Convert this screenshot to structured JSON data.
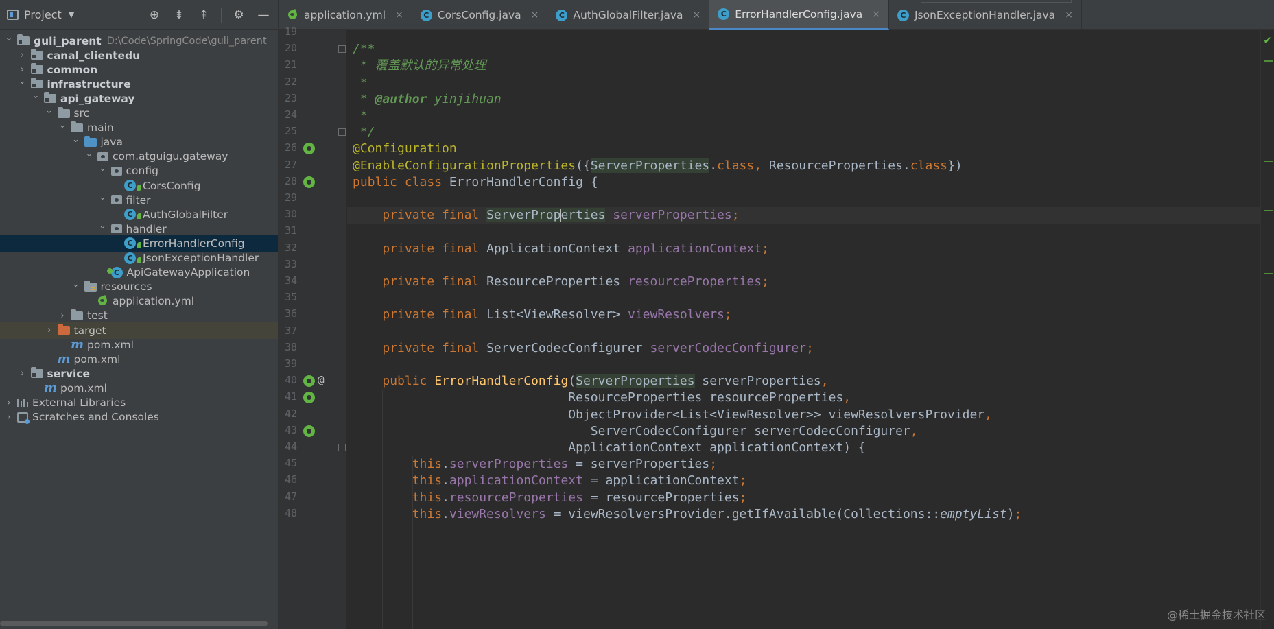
{
  "panel": {
    "title": "Project",
    "tree": [
      {
        "label": "guli_parent",
        "path": "D:\\Code\\SpringCode\\guli_parent",
        "indent": 0,
        "chevron": "open",
        "icon": "module-folder",
        "bold": true
      },
      {
        "label": "canal_clientedu",
        "indent": 1,
        "chevron": "closed",
        "icon": "module-folder",
        "bold": true
      },
      {
        "label": "common",
        "indent": 1,
        "chevron": "closed",
        "icon": "module-folder",
        "bold": true
      },
      {
        "label": "infrastructure",
        "indent": 1,
        "chevron": "open",
        "icon": "module-folder",
        "bold": true
      },
      {
        "label": "api_gateway",
        "indent": 2,
        "chevron": "open",
        "icon": "module-folder",
        "bold": true
      },
      {
        "label": "src",
        "indent": 3,
        "chevron": "open",
        "icon": "folder"
      },
      {
        "label": "main",
        "indent": 4,
        "chevron": "open",
        "icon": "folder"
      },
      {
        "label": "java",
        "indent": 5,
        "chevron": "open",
        "icon": "source-folder"
      },
      {
        "label": "com.atguigu.gateway",
        "indent": 6,
        "chevron": "open",
        "icon": "package"
      },
      {
        "label": "config",
        "indent": 7,
        "chevron": "open",
        "icon": "package"
      },
      {
        "label": "CorsConfig",
        "indent": 8,
        "chevron": "none",
        "icon": "spring-class"
      },
      {
        "label": "filter",
        "indent": 7,
        "chevron": "open",
        "icon": "package"
      },
      {
        "label": "AuthGlobalFilter",
        "indent": 8,
        "chevron": "none",
        "icon": "spring-class"
      },
      {
        "label": "handler",
        "indent": 7,
        "chevron": "open",
        "icon": "package"
      },
      {
        "label": "ErrorHandlerConfig",
        "indent": 8,
        "chevron": "none",
        "icon": "spring-class",
        "selected": true
      },
      {
        "label": "JsonExceptionHandler",
        "indent": 8,
        "chevron": "none",
        "icon": "spring-class"
      },
      {
        "label": "ApiGatewayApplication",
        "indent": 7,
        "chevron": "none",
        "icon": "boot-class"
      },
      {
        "label": "resources",
        "indent": 5,
        "chevron": "open",
        "icon": "resources-folder"
      },
      {
        "label": "application.yml",
        "indent": 6,
        "chevron": "none",
        "icon": "yml"
      },
      {
        "label": "test",
        "indent": 4,
        "chevron": "closed",
        "icon": "folder"
      },
      {
        "label": "target",
        "indent": 3,
        "chevron": "closed",
        "icon": "excluded-folder",
        "highlighted": true
      },
      {
        "label": "pom.xml",
        "indent": 4,
        "chevron": "none",
        "icon": "maven"
      },
      {
        "label": "pom.xml",
        "indent": 3,
        "chevron": "none",
        "icon": "maven"
      },
      {
        "label": "service",
        "indent": 1,
        "chevron": "closed",
        "icon": "module-folder",
        "bold": true
      },
      {
        "label": "pom.xml",
        "indent": 2,
        "chevron": "none",
        "icon": "maven"
      },
      {
        "label": "External Libraries",
        "indent": 0,
        "chevron": "closed",
        "icon": "libraries"
      },
      {
        "label": "Scratches and Consoles",
        "indent": 0,
        "chevron": "closed",
        "icon": "scratches"
      }
    ]
  },
  "tabs": [
    {
      "label": "application.yml",
      "icon": "yml"
    },
    {
      "label": "CorsConfig.java",
      "icon": "class"
    },
    {
      "label": "AuthGlobalFilter.java",
      "icon": "class"
    },
    {
      "label": "ErrorHandlerConfig.java",
      "icon": "class",
      "active": true
    },
    {
      "label": "JsonExceptionHandler.java",
      "icon": "class"
    }
  ],
  "editor": {
    "current_line": 30,
    "lines": [
      {
        "n": 19,
        "tokens": []
      },
      {
        "n": 20,
        "tokens": [
          [
            "cmt",
            "/**"
          ]
        ],
        "fold": true
      },
      {
        "n": 21,
        "tokens": [
          [
            "cmt",
            " * 覆盖默认的异常处理"
          ]
        ]
      },
      {
        "n": 22,
        "tokens": [
          [
            "cmt",
            " *"
          ]
        ]
      },
      {
        "n": 23,
        "tokens": [
          [
            "cmt",
            " * "
          ],
          [
            "tag",
            "@author"
          ],
          [
            "cmt",
            " yinjihuan"
          ]
        ]
      },
      {
        "n": 24,
        "tokens": [
          [
            "cmt",
            " *"
          ]
        ]
      },
      {
        "n": 25,
        "tokens": [
          [
            "cmt",
            " */"
          ]
        ],
        "fold": true
      },
      {
        "n": 26,
        "tokens": [
          [
            "ann",
            "@Configuration"
          ]
        ],
        "gutter": "bean"
      },
      {
        "n": 27,
        "tokens": [
          [
            "ann",
            "@EnableConfigurationProperties"
          ],
          [
            "pl",
            "({"
          ],
          [
            "typhl",
            "ServerProperties"
          ],
          [
            "pl",
            "."
          ],
          [
            "kw",
            "class"
          ],
          [
            "kw",
            ", "
          ],
          [
            "pl",
            "ResourceProperties."
          ],
          [
            "kw",
            "class"
          ],
          [
            "pl",
            "})"
          ]
        ]
      },
      {
        "n": 28,
        "tokens": [
          [
            "kw",
            "public class "
          ],
          [
            "pl",
            "ErrorHandlerConfig {"
          ]
        ],
        "gutter": "bean"
      },
      {
        "n": 29,
        "tokens": []
      },
      {
        "n": 30,
        "tokens": [
          [
            "pl",
            "    "
          ],
          [
            "kw",
            "private final "
          ],
          [
            "typhl",
            "ServerProp"
          ],
          [
            "caret",
            ""
          ],
          [
            "typhl",
            "erties"
          ],
          [
            "pl",
            " "
          ],
          [
            "fld",
            "serverProperties"
          ],
          [
            "kw",
            ";"
          ]
        ]
      },
      {
        "n": 31,
        "tokens": []
      },
      {
        "n": 32,
        "tokens": [
          [
            "pl",
            "    "
          ],
          [
            "kw",
            "private final "
          ],
          [
            "pl",
            "ApplicationContext "
          ],
          [
            "fld",
            "applicationContext"
          ],
          [
            "kw",
            ";"
          ]
        ]
      },
      {
        "n": 33,
        "tokens": []
      },
      {
        "n": 34,
        "tokens": [
          [
            "pl",
            "    "
          ],
          [
            "kw",
            "private final "
          ],
          [
            "pl",
            "ResourceProperties "
          ],
          [
            "fld",
            "resourceProperties"
          ],
          [
            "kw",
            ";"
          ]
        ]
      },
      {
        "n": 35,
        "tokens": []
      },
      {
        "n": 36,
        "tokens": [
          [
            "pl",
            "    "
          ],
          [
            "kw",
            "private final "
          ],
          [
            "pl",
            "List<ViewResolver> "
          ],
          [
            "fld",
            "viewResolvers"
          ],
          [
            "kw",
            ";"
          ]
        ]
      },
      {
        "n": 37,
        "tokens": []
      },
      {
        "n": 38,
        "tokens": [
          [
            "pl",
            "    "
          ],
          [
            "kw",
            "private final "
          ],
          [
            "pl",
            "ServerCodecConfigurer "
          ],
          [
            "fld",
            "serverCodecConfigurer"
          ],
          [
            "kw",
            ";"
          ]
        ]
      },
      {
        "n": 39,
        "tokens": []
      },
      {
        "n": 40,
        "tokens": [
          [
            "pl",
            "    "
          ],
          [
            "kw",
            "public "
          ],
          [
            "fn",
            "ErrorHandlerConfig"
          ],
          [
            "pl",
            "("
          ],
          [
            "typhl",
            "ServerProperties"
          ],
          [
            "pl",
            " serverProperties"
          ],
          [
            "kw",
            ","
          ]
        ],
        "gutter": "bean",
        "at": "@"
      },
      {
        "n": 41,
        "tokens": [
          [
            "pl",
            "                             ResourceProperties resourceProperties"
          ],
          [
            "kw",
            ","
          ]
        ],
        "gutter": "bean"
      },
      {
        "n": 42,
        "tokens": [
          [
            "pl",
            "                             ObjectProvider<List<ViewResolver>> viewResolversProvider"
          ],
          [
            "kw",
            ","
          ]
        ]
      },
      {
        "n": 43,
        "tokens": [
          [
            "pl",
            "                                ServerCodecConfigurer serverCodecConfigurer"
          ],
          [
            "kw",
            ","
          ]
        ],
        "gutter": "bean"
      },
      {
        "n": 44,
        "tokens": [
          [
            "pl",
            "                             ApplicationContext applicationContext) {"
          ]
        ],
        "fold": true
      },
      {
        "n": 45,
        "tokens": [
          [
            "pl",
            "        "
          ],
          [
            "kw",
            "this"
          ],
          [
            "pl",
            "."
          ],
          [
            "fld",
            "serverProperties"
          ],
          [
            "pl",
            " = serverProperties"
          ],
          [
            "kw",
            ";"
          ]
        ]
      },
      {
        "n": 46,
        "tokens": [
          [
            "pl",
            "        "
          ],
          [
            "kw",
            "this"
          ],
          [
            "pl",
            "."
          ],
          [
            "fld",
            "applicationContext"
          ],
          [
            "pl",
            " = applicationContext"
          ],
          [
            "kw",
            ";"
          ]
        ]
      },
      {
        "n": 47,
        "tokens": [
          [
            "pl",
            "        "
          ],
          [
            "kw",
            "this"
          ],
          [
            "pl",
            "."
          ],
          [
            "fld",
            "resourceProperties"
          ],
          [
            "pl",
            " = resourceProperties"
          ],
          [
            "kw",
            ";"
          ]
        ]
      },
      {
        "n": 48,
        "tokens": [
          [
            "pl",
            "        "
          ],
          [
            "kw",
            "this"
          ],
          [
            "pl",
            "."
          ],
          [
            "fld",
            "viewResolvers"
          ],
          [
            "pl",
            " = viewResolversProvider.getIfAvailable(Collections::"
          ],
          [
            "ital",
            "emptyList"
          ],
          [
            "pl",
            ")"
          ],
          [
            "kw",
            ";"
          ]
        ]
      }
    ]
  },
  "watermark": "@稀土掘金技术社区"
}
